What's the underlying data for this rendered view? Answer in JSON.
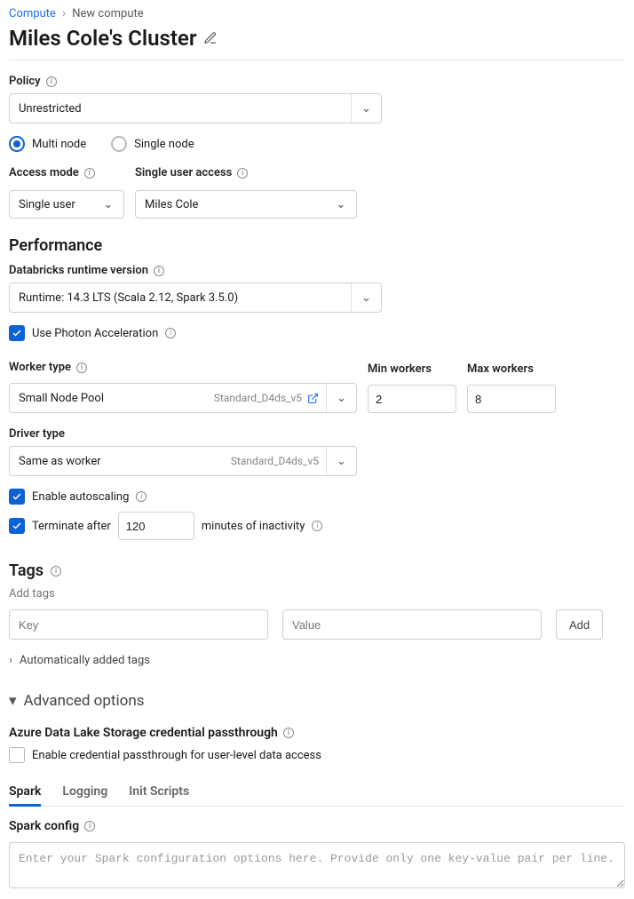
{
  "breadcrumb": {
    "root": "Compute",
    "current": "New compute"
  },
  "title": "Miles Cole's Cluster",
  "policy": {
    "label": "Policy",
    "value": "Unrestricted"
  },
  "nodeMode": {
    "multi": "Multi node",
    "single": "Single node",
    "selected": "multi"
  },
  "accessMode": {
    "label": "Access mode",
    "value": "Single user"
  },
  "singleUserAccess": {
    "label": "Single user access",
    "value": "Miles Cole"
  },
  "performance": {
    "heading": "Performance",
    "runtimeLabel": "Databricks runtime version",
    "runtimeValue": "Runtime: 14.3 LTS (Scala 2.12, Spark 3.5.0)",
    "photonLabel": "Use Photon Acceleration",
    "photonChecked": true,
    "workerTypeLabel": "Worker type",
    "workerTypeName": "Small Node Pool",
    "workerTypeSku": "Standard_D4ds_v5",
    "minWorkersLabel": "Min workers",
    "minWorkers": "2",
    "maxWorkersLabel": "Max workers",
    "maxWorkers": "8",
    "driverTypeLabel": "Driver type",
    "driverTypeName": "Same as worker",
    "driverTypeSku": "Standard_D4ds_v5",
    "autoscaleLabel": "Enable autoscaling",
    "autoscaleChecked": true,
    "terminateLabel": "Terminate after",
    "terminateChecked": true,
    "terminateMinutes": "120",
    "terminateSuffix": "minutes of inactivity"
  },
  "tags": {
    "heading": "Tags",
    "addTags": "Add tags",
    "keyPlaceholder": "Key",
    "valuePlaceholder": "Value",
    "addButton": "Add",
    "autoTags": "Automatically added tags"
  },
  "advanced": {
    "heading": "Advanced options",
    "adlsHeading": "Azure Data Lake Storage credential passthrough",
    "adlsCheckbox": "Enable credential passthrough for user-level data access",
    "adlsChecked": false,
    "tabs": {
      "spark": "Spark",
      "logging": "Logging",
      "init": "Init Scripts",
      "active": "spark"
    },
    "sparkConfigLabel": "Spark config",
    "sparkConfigPlaceholder": "Enter your Spark configuration options here. Provide only one key-value pair per line."
  }
}
